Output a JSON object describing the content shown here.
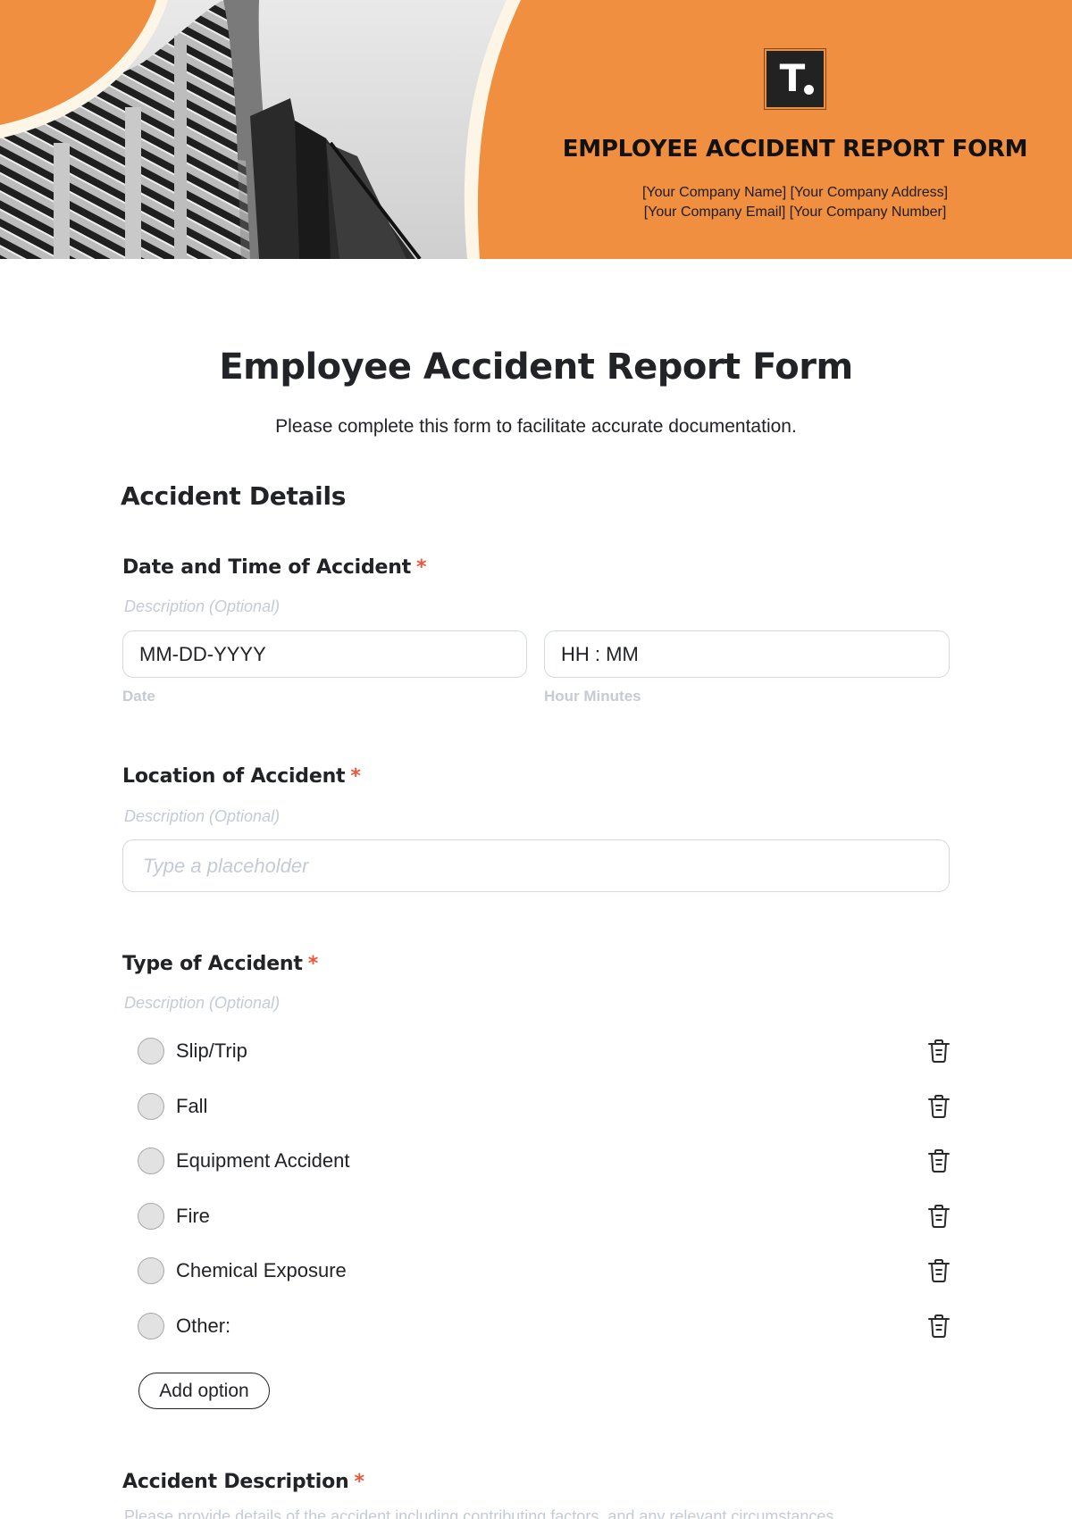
{
  "header": {
    "logo_letter": "T",
    "title": "EMPLOYEE ACCIDENT REPORT FORM",
    "company_line_1": "[Your Company Name] [Your Company Address]",
    "company_line_2": "[Your Company Email] [Your Company Number]"
  },
  "form": {
    "title": "Employee Accident Report Form",
    "subtitle": "Please complete this form to facilitate accurate documentation.",
    "section_title": "Accident Details",
    "required_mark": "*",
    "questions": {
      "date_time": {
        "label": "Date and Time of Accident",
        "description": "Description (Optional)",
        "date_value": "MM-DD-YYYY",
        "date_sublabel": "Date",
        "time_value": "HH : MM",
        "time_sublabel": "Hour Minutes"
      },
      "location": {
        "label": "Location of Accident",
        "description": "Description (Optional)",
        "placeholder": "Type a placeholder"
      },
      "type": {
        "label": "Type of Accident",
        "description": "Description (Optional)",
        "options": [
          "Slip/Trip",
          "Fall",
          "Equipment Accident",
          "Fire",
          "Chemical Exposure",
          "Other:"
        ],
        "add_option_label": "Add option"
      },
      "description": {
        "label": "Accident Description",
        "description": "Please provide details of the accident including contributing factors, and any relevant circumstances."
      }
    }
  },
  "colors": {
    "brand_orange": "#f08f3f",
    "cream_border": "#fdf6e6",
    "required_red": "#f0553a",
    "muted_text": "#c4cbd6"
  },
  "icons": {
    "delete": "trash-icon",
    "logo": "brand-logo-icon"
  }
}
